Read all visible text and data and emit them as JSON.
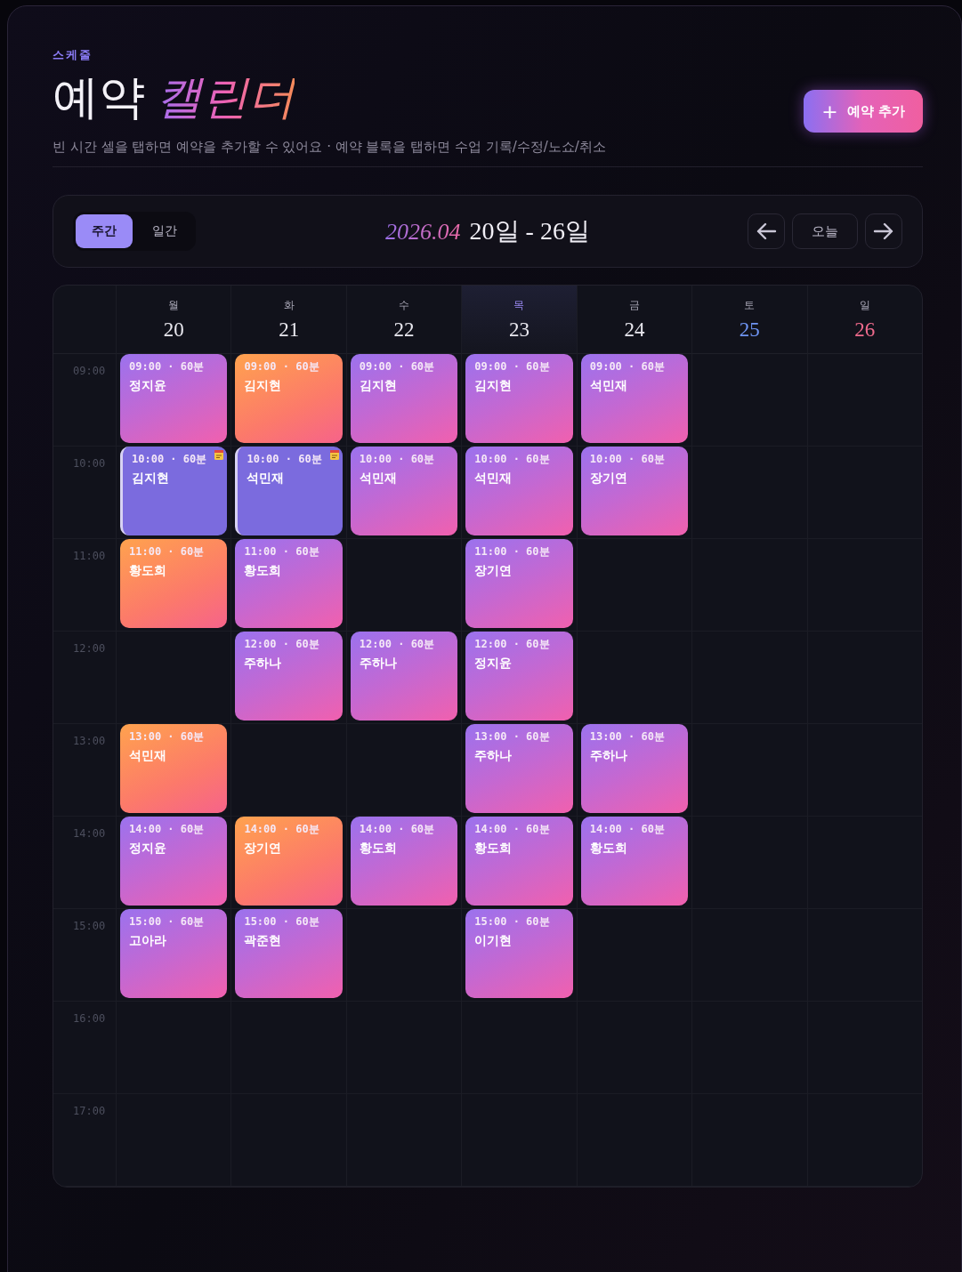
{
  "header": {
    "eyebrow": "스케줄",
    "title": "예약",
    "title_accent": "캘린더",
    "subtitle": "빈 시간 셀을 탭하면 예약을 추가할 수 있어요 · 예약 블록을 탭하면 수업 기록/수정/노쇼/취소",
    "add_button": {
      "icon": "+",
      "label": "예약 추가"
    }
  },
  "toolbar": {
    "views": [
      {
        "label": "주간",
        "selected": true
      },
      {
        "label": "일간",
        "selected": false
      }
    ],
    "month": "2026.04",
    "range": "20일 - 26일",
    "today_button": "오늘"
  },
  "days": [
    {
      "weekday": "월",
      "date": "20",
      "kind": "weekday",
      "selected": false
    },
    {
      "weekday": "화",
      "date": "21",
      "kind": "weekday",
      "selected": false
    },
    {
      "weekday": "수",
      "date": "22",
      "kind": "weekday",
      "selected": false
    },
    {
      "weekday": "목",
      "date": "23",
      "kind": "weekday",
      "selected": true
    },
    {
      "weekday": "금",
      "date": "24",
      "kind": "weekday",
      "selected": false
    },
    {
      "weekday": "토",
      "date": "25",
      "kind": "saturday",
      "selected": false
    },
    {
      "weekday": "일",
      "date": "26",
      "kind": "sunday",
      "selected": false
    }
  ],
  "hours": [
    {
      "label": "09:00",
      "slots": [
        {
          "kind": "purple",
          "time": "09:00 · 60분",
          "name": "정지윤"
        },
        {
          "kind": "orange",
          "time": "09:00 · 60분",
          "name": "김지현"
        },
        {
          "kind": "purple",
          "time": "09:00 · 60분",
          "name": "김지현"
        },
        {
          "kind": "purple",
          "time": "09:00 · 60분",
          "name": "김지현"
        },
        {
          "kind": "purple",
          "time": "09:00 · 60분",
          "name": "석민재"
        },
        {
          "kind": "empty"
        },
        {
          "kind": "empty"
        }
      ]
    },
    {
      "label": "10:00",
      "slots": [
        {
          "kind": "done",
          "time": "10:00 · 60분",
          "name": "김지현"
        },
        {
          "kind": "done",
          "time": "10:00 · 60분",
          "name": "석민재"
        },
        {
          "kind": "purple",
          "time": "10:00 · 60분",
          "name": "석민재"
        },
        {
          "kind": "purple",
          "time": "10:00 · 60분",
          "name": "석민재"
        },
        {
          "kind": "purple",
          "time": "10:00 · 60분",
          "name": "장기연"
        },
        {
          "kind": "empty"
        },
        {
          "kind": "empty"
        }
      ]
    },
    {
      "label": "11:00",
      "slots": [
        {
          "kind": "orange",
          "time": "11:00 · 60분",
          "name": "황도희"
        },
        {
          "kind": "purple",
          "time": "11:00 · 60분",
          "name": "황도희"
        },
        {
          "kind": "empty"
        },
        {
          "kind": "purple",
          "time": "11:00 · 60분",
          "name": "장기연"
        },
        {
          "kind": "empty"
        },
        {
          "kind": "empty"
        },
        {
          "kind": "empty"
        }
      ]
    },
    {
      "label": "12:00",
      "slots": [
        {
          "kind": "empty"
        },
        {
          "kind": "purple",
          "time": "12:00 · 60분",
          "name": "주하나"
        },
        {
          "kind": "purple",
          "time": "12:00 · 60분",
          "name": "주하나"
        },
        {
          "kind": "purple",
          "time": "12:00 · 60분",
          "name": "정지윤"
        },
        {
          "kind": "empty"
        },
        {
          "kind": "empty"
        },
        {
          "kind": "empty"
        }
      ]
    },
    {
      "label": "13:00",
      "slots": [
        {
          "kind": "orange",
          "time": "13:00 · 60분",
          "name": "석민재"
        },
        {
          "kind": "empty"
        },
        {
          "kind": "empty"
        },
        {
          "kind": "purple",
          "time": "13:00 · 60분",
          "name": "주하나"
        },
        {
          "kind": "purple",
          "time": "13:00 · 60분",
          "name": "주하나"
        },
        {
          "kind": "empty"
        },
        {
          "kind": "empty"
        }
      ]
    },
    {
      "label": "14:00",
      "slots": [
        {
          "kind": "purple",
          "time": "14:00 · 60분",
          "name": "정지윤"
        },
        {
          "kind": "orange",
          "time": "14:00 · 60분",
          "name": "장기연"
        },
        {
          "kind": "purple",
          "time": "14:00 · 60분",
          "name": "황도희"
        },
        {
          "kind": "purple",
          "time": "14:00 · 60분",
          "name": "황도희"
        },
        {
          "kind": "purple",
          "time": "14:00 · 60분",
          "name": "황도희"
        },
        {
          "kind": "empty"
        },
        {
          "kind": "empty"
        }
      ]
    },
    {
      "label": "15:00",
      "slots": [
        {
          "kind": "purple",
          "time": "15:00 · 60분",
          "name": "고아라"
        },
        {
          "kind": "purple",
          "time": "15:00 · 60분",
          "name": "곽준현"
        },
        {
          "kind": "empty"
        },
        {
          "kind": "purple",
          "time": "15:00 · 60분",
          "name": "이기현"
        },
        {
          "kind": "empty"
        },
        {
          "kind": "empty"
        },
        {
          "kind": "empty"
        }
      ]
    },
    {
      "label": "16:00",
      "slots": [
        {
          "kind": "empty"
        },
        {
          "kind": "empty"
        },
        {
          "kind": "empty"
        },
        {
          "kind": "empty"
        },
        {
          "kind": "empty"
        },
        {
          "kind": "empty"
        },
        {
          "kind": "empty"
        }
      ]
    },
    {
      "label": "17:00",
      "slots": [
        {
          "kind": "empty"
        },
        {
          "kind": "empty"
        },
        {
          "kind": "empty"
        },
        {
          "kind": "empty"
        },
        {
          "kind": "empty"
        },
        {
          "kind": "empty"
        },
        {
          "kind": "empty"
        }
      ]
    }
  ]
}
